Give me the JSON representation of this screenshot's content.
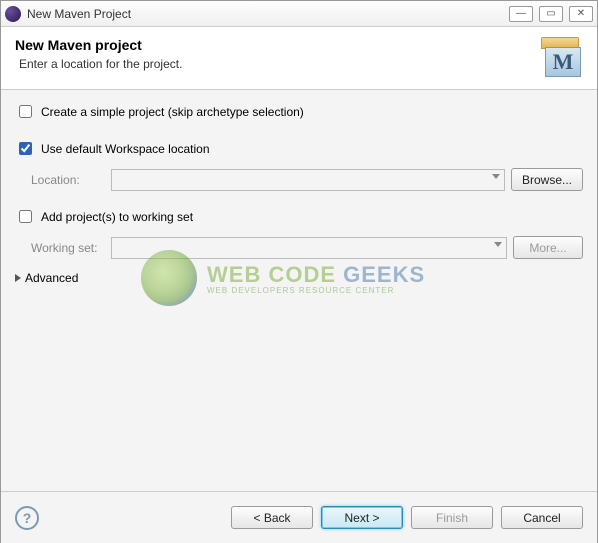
{
  "window": {
    "title": "New Maven Project"
  },
  "header": {
    "title": "New Maven project",
    "subtitle": "Enter a location for the project."
  },
  "options": {
    "simple_project": {
      "label": "Create a simple project (skip archetype selection)",
      "checked": false
    },
    "use_default_location": {
      "label": "Use default Workspace location",
      "checked": true
    },
    "location_label": "Location:",
    "location_value": "",
    "browse_label": "Browse...",
    "add_working_set": {
      "label": "Add project(s) to working set",
      "checked": false
    },
    "working_set_label": "Working set:",
    "working_set_value": "",
    "more_label": "More...",
    "advanced_label": "Advanced"
  },
  "watermark": {
    "line1_a": "WEB CODE ",
    "line1_b": "GEEKS",
    "line2": "WEB DEVELOPERS RESOURCE CENTER"
  },
  "footer": {
    "back": "< Back",
    "next": "Next >",
    "finish": "Finish",
    "cancel": "Cancel"
  }
}
